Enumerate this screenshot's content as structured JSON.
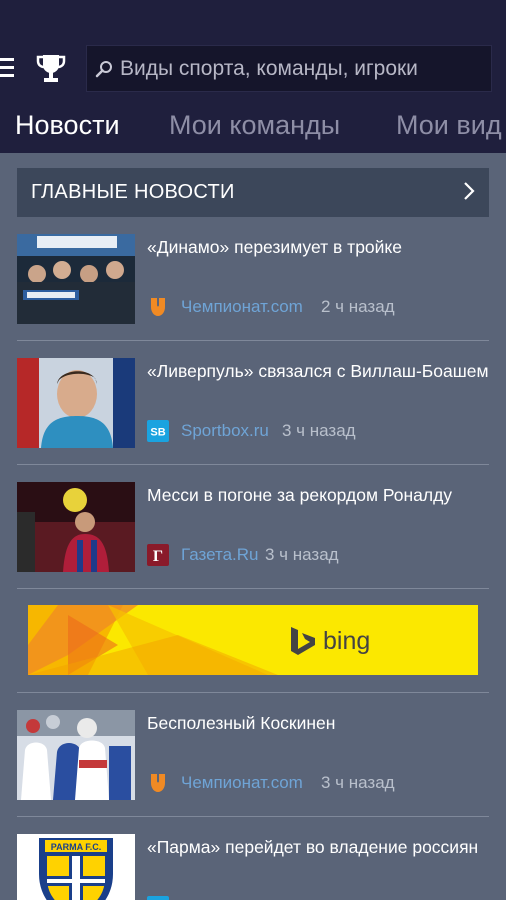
{
  "header": {
    "search_placeholder": "Виды спорта, команды, игроки",
    "icons": {
      "menu": "hamburger-menu-icon",
      "trophy": "trophy-icon",
      "search": "search-icon"
    }
  },
  "tabs": [
    {
      "label": "Новости",
      "active": true
    },
    {
      "label": "Мои команды",
      "active": false
    },
    {
      "label": "Мои вид",
      "active": false
    }
  ],
  "section": {
    "title": "ГЛАВНЫЕ НОВОСТИ",
    "chevron": "chevron-right-icon"
  },
  "news": [
    {
      "headline": "«Динамо» перезимует в тройке",
      "source": "Чемпионат.com",
      "time": "2 ч назад"
    },
    {
      "headline": "«Ливерпуль» связался с Виллаш-Боашем",
      "source": "Sportbox.ru",
      "time": "3 ч назад"
    },
    {
      "headline": "Месси в погоне за рекордом Роналду",
      "source": "Газета.Ru",
      "time": "3 ч назад"
    },
    {
      "headline": "Бесполезный Коскинен",
      "source": "Чемпионат.com",
      "time": "3 ч назад"
    },
    {
      "headline": "«Парма» перейдет во владение россиян",
      "source": "",
      "time": ""
    }
  ],
  "ad": {
    "brand": "bing"
  },
  "colors": {
    "header_bg": "#1f1f3d",
    "page_bg": "#5a6478",
    "section_bg": "#3c475a",
    "link_blue": "#6fa4d6",
    "championat_orange": "#f08a24",
    "sportbox_blue": "#1aa3e0",
    "gazeta_red": "#8a1a2a",
    "ad_yellow": "#fbe800"
  },
  "source_logos": {
    "championat": "Ч",
    "sportbox": "SB",
    "gazeta": "Г"
  },
  "parma_crest_text": "PARMA F.C."
}
